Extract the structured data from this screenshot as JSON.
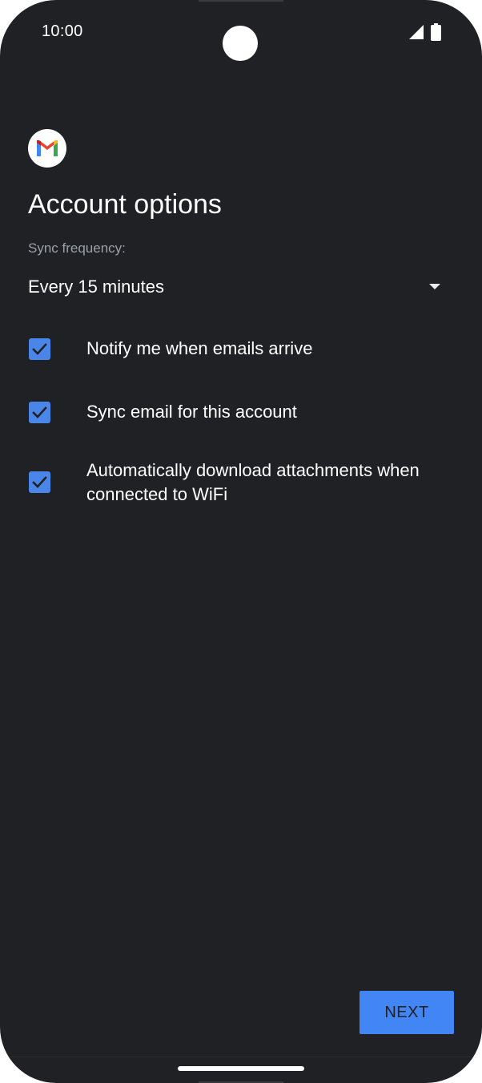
{
  "status_bar": {
    "time": "10:00"
  },
  "icons": {
    "app_logo": "gmail-logo-icon",
    "signal": "cellular-signal-icon",
    "battery": "battery-icon",
    "dropdown_arrow": "dropdown-arrow-icon",
    "checkmark": "checkmark-icon"
  },
  "page": {
    "title": "Account options"
  },
  "sync": {
    "label": "Sync frequency:",
    "selected_value": "Every 15 minutes"
  },
  "options": [
    {
      "label": "Notify me when emails arrive",
      "checked": true
    },
    {
      "label": "Sync email for this account",
      "checked": true
    },
    {
      "label": "Automatically download attachments when connected to WiFi",
      "checked": true
    }
  ],
  "actions": {
    "next_label": "NEXT"
  },
  "colors": {
    "background": "#202124",
    "accent": "#4285f4",
    "checkbox": "#4a86e8",
    "text_primary": "#ffffff",
    "text_secondary": "#9aa0a6"
  }
}
